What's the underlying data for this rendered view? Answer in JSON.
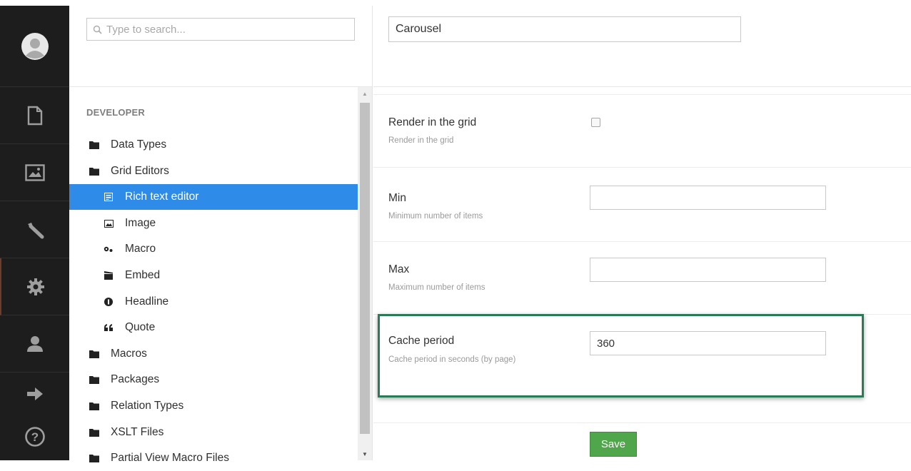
{
  "search": {
    "placeholder": "Type to search..."
  },
  "sidebar": {
    "icons": [
      "user-avatar-icon",
      "document-icon",
      "image-icon",
      "wrench-icon",
      "gear-icon",
      "user-icon",
      "arrow-right-icon",
      "help-icon"
    ]
  },
  "tree": {
    "section_title": "DEVELOPER",
    "items": [
      {
        "label": "Data Types",
        "icon": "folder-icon",
        "level": 1
      },
      {
        "label": "Grid Editors",
        "icon": "folder-icon",
        "level": 1
      },
      {
        "label": "Rich text editor",
        "icon": "rich-text-icon",
        "level": 2,
        "selected": true
      },
      {
        "label": "Image",
        "icon": "image-icon",
        "level": 2
      },
      {
        "label": "Macro",
        "icon": "gears-icon",
        "level": 2
      },
      {
        "label": "Embed",
        "icon": "clapperboard-icon",
        "level": 2
      },
      {
        "label": "Headline",
        "icon": "headline-icon",
        "level": 2
      },
      {
        "label": "Quote",
        "icon": "quote-icon",
        "level": 2
      },
      {
        "label": "Macros",
        "icon": "folder-icon",
        "level": 1
      },
      {
        "label": "Packages",
        "icon": "folder-icon",
        "level": 1
      },
      {
        "label": "Relation Types",
        "icon": "folder-icon",
        "level": 1
      },
      {
        "label": "XSLT Files",
        "icon": "folder-icon",
        "level": 1
      },
      {
        "label": "Partial View Macro Files",
        "icon": "folder-icon",
        "level": 1
      }
    ]
  },
  "editor": {
    "name_value": "Carousel",
    "properties": {
      "render_grid": {
        "label": "Render in the grid",
        "description": "Render in the grid",
        "checked": false
      },
      "min": {
        "label": "Min",
        "description": "Minimum number of items",
        "value": ""
      },
      "max": {
        "label": "Max",
        "description": "Maximum number of items",
        "value": ""
      },
      "cache": {
        "label": "Cache period",
        "description": "Cache period in seconds (by page)",
        "value": "360"
      }
    },
    "save_label": "Save"
  },
  "colors": {
    "selected_bg": "#2e8be8",
    "save_green": "#50a64a",
    "highlight_border": "#2a7a58",
    "sidebar_bg": "#1d1d1d"
  }
}
